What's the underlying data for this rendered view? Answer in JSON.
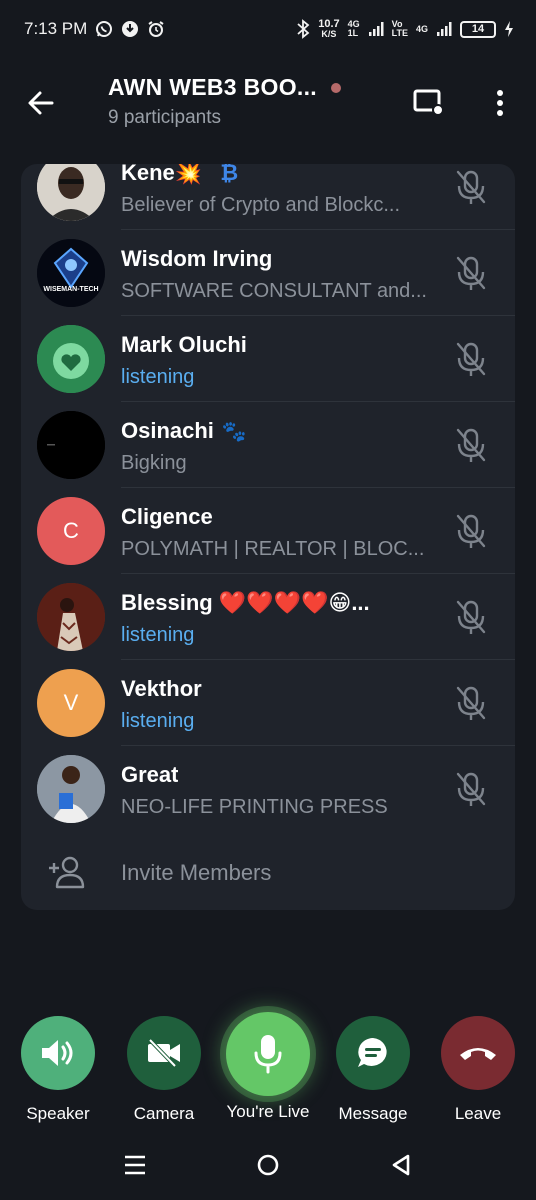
{
  "status_bar": {
    "time": "7:13 PM",
    "net_speed_value": "10.7",
    "net_speed_unit": "K/S",
    "sig1_top": "4G",
    "sig1_bottom": "1L",
    "sig2_top": "Vo",
    "sig2_bottom": "LTE",
    "sig3_top": "4G",
    "battery": "14"
  },
  "header": {
    "title": "AWN WEB3 BOO...",
    "subtitle": "9 participants"
  },
  "participants": [
    {
      "name": "Kene💥",
      "extra": "₿",
      "status": "Believer of Crypto and Blockc...",
      "listening": false,
      "avatar_color": "#d9d4cc",
      "avatar_letter": ""
    },
    {
      "name": "Wisdom Irving",
      "extra": "",
      "status": "SOFTWARE CONSULTANT and...",
      "listening": false,
      "avatar_color": "#0b0f1c",
      "avatar_letter": "",
      "avatar_text": "WISEMAN-TECH"
    },
    {
      "name": "Mark Oluchi",
      "extra": "",
      "status": "listening",
      "listening": true,
      "avatar_color": "#2f9a5a",
      "avatar_letter": ""
    },
    {
      "name": "Osinachi",
      "extra": "🐾",
      "status": "Bigking",
      "listening": false,
      "avatar_color": "#000000",
      "avatar_letter": ""
    },
    {
      "name": "Cligence",
      "extra": "",
      "status": "POLYMATH | REALTOR | BLOC...",
      "listening": false,
      "avatar_color": "#e35a5a",
      "avatar_letter": "C"
    },
    {
      "name": "Blessing ❤️❤️❤️❤️😁...",
      "extra": "",
      "status": "listening",
      "listening": true,
      "avatar_color": "#6b2a1e",
      "avatar_letter": ""
    },
    {
      "name": "Vekthor",
      "extra": "",
      "status": "listening",
      "listening": true,
      "avatar_color": "#eea04f",
      "avatar_letter": "V"
    },
    {
      "name": "Great",
      "extra": "",
      "status": "NEO-LIFE PRINTING PRESS",
      "listening": false,
      "avatar_color": "#7a8591",
      "avatar_letter": ""
    }
  ],
  "invite": {
    "label": "Invite Members"
  },
  "controls": {
    "speaker": {
      "label": "Speaker",
      "color": "#4fb07b"
    },
    "camera": {
      "label": "Camera",
      "color": "#1f5f3c"
    },
    "live": {
      "label": "You're Live",
      "color": "#64c767"
    },
    "message": {
      "label": "Message",
      "color": "#1f5f3c"
    },
    "leave": {
      "label": "Leave",
      "color": "#7a2b31"
    }
  }
}
